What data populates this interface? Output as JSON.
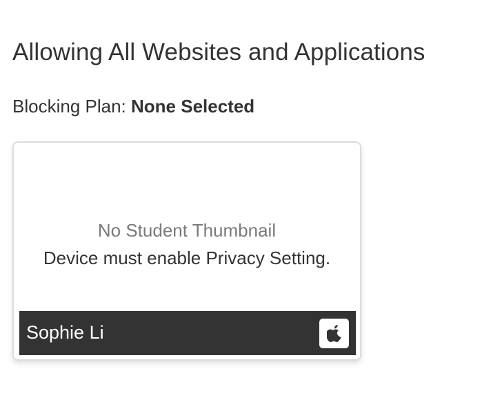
{
  "header": {
    "title": "Allowing All Websites and Applications"
  },
  "blocking_plan": {
    "label": "Blocking Plan:",
    "value": "None Selected"
  },
  "student_card": {
    "thumbnail_title": "No Student Thumbnail",
    "thumbnail_note": "Device must enable Privacy Setting.",
    "student_name": "Sophie Li",
    "device_icon": "apple-icon"
  },
  "colors": {
    "bar_background": "#333333",
    "muted_text": "#7a7a7a",
    "card_border": "#dcdcdc"
  }
}
